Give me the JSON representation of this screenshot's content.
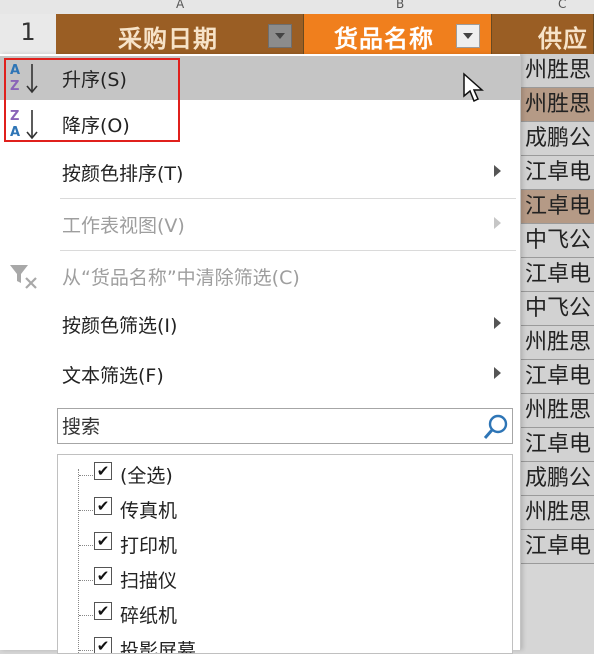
{
  "sheet": {
    "column_letters": [
      "A",
      "B",
      "C"
    ],
    "row_number": "1",
    "headers": [
      {
        "label": "采购日期"
      },
      {
        "label": "货品名称"
      },
      {
        "label": "供应"
      }
    ],
    "column_c_cells": [
      "州胜思",
      "州胜思",
      "成鹏公",
      "江卓电",
      "江卓电",
      "中飞公",
      "江卓电",
      "中飞公",
      "州胜思",
      "江卓电",
      "州胜思",
      "江卓电",
      "成鹏公",
      "州胜思",
      "江卓电"
    ]
  },
  "menu": {
    "sort_ascending": "升序(S)",
    "sort_descending": "降序(O)",
    "sort_by_color": "按颜色排序(T)",
    "sheet_view": "工作表视图(V)",
    "clear_filter": "从“货品名称”中清除筛选(C)",
    "filter_by_color": "按颜色筛选(I)",
    "text_filter": "文本筛选(F)",
    "search_placeholder": "搜索",
    "items": [
      {
        "label": "(全选)",
        "checked": true
      },
      {
        "label": "传真机",
        "checked": true
      },
      {
        "label": "打印机",
        "checked": true
      },
      {
        "label": "扫描仪",
        "checked": true
      },
      {
        "label": "碎纸机",
        "checked": true
      },
      {
        "label": "投影屏幕",
        "checked": true
      }
    ]
  },
  "icons": {
    "sort_asc": "sort-ascending-icon",
    "sort_desc": "sort-descending-icon",
    "clear_filter": "clear-filter-icon",
    "search": "search-icon",
    "checkbox_mark": "✔"
  },
  "colors": {
    "header_active": "#f07f1d",
    "header_dimmed": "#9a5e24",
    "highlight": "#c5c5c5",
    "annotation_red": "#e0201c",
    "icon_blue": "#2e75b6",
    "icon_purple": "#8a64b8"
  }
}
